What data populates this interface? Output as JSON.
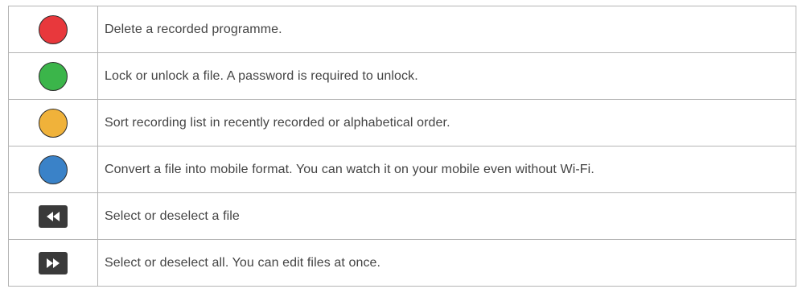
{
  "rows": [
    {
      "icon": "red-button-icon",
      "color": "#e8383c",
      "text": "Delete a recorded programme."
    },
    {
      "icon": "green-button-icon",
      "color": "#3bb54a",
      "text": "Lock or unlock a file. A password is required to unlock."
    },
    {
      "icon": "yellow-button-icon",
      "color": "#f0b23a",
      "text": "Sort recording list in recently recorded or alphabetical order."
    },
    {
      "icon": "blue-button-icon",
      "color": "#3a82c8",
      "text": "Convert a file into mobile format. You can watch it on your mobile even without Wi-Fi."
    },
    {
      "icon": "rewind-button-icon",
      "color": "#3a3a3a",
      "text": "Select or deselect a file"
    },
    {
      "icon": "fast-forward-button-icon",
      "color": "#3a3a3a",
      "text": "Select or deselect all. You can edit files at once."
    }
  ]
}
